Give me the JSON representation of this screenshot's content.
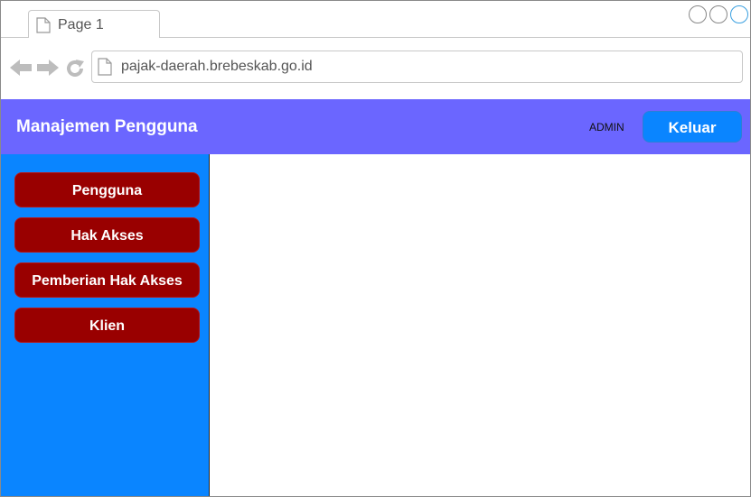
{
  "browser": {
    "tab_title": "Page 1",
    "url": "pajak-daerah.brebeskab.go.id"
  },
  "header": {
    "title": "Manajemen Pengguna",
    "user": "ADMIN",
    "logout_label": "Keluar"
  },
  "sidebar": {
    "items": [
      {
        "label": "Pengguna"
      },
      {
        "label": "Hak Akses"
      },
      {
        "label": "Pemberian Hak Akses"
      },
      {
        "label": "Klien"
      }
    ]
  },
  "colors": {
    "header_bg": "#6b66ff",
    "sidebar_bg": "#0a85ff",
    "menu_button_bg": "#990000",
    "logout_button_bg": "#0a85ff"
  },
  "icons": [
    "page-icon",
    "back-arrow-icon",
    "forward-arrow-icon",
    "reload-icon",
    "window-control-icon"
  ]
}
